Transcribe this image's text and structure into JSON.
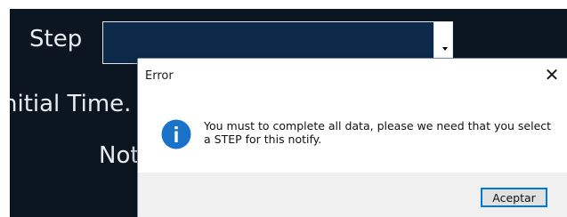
{
  "form": {
    "step_label": "Step",
    "initial_time_label": "nitial Time.",
    "notify_label": "Not",
    "step_select": {
      "selected_value": ""
    }
  },
  "dialog": {
    "title": "Error",
    "close_glyph": "✕",
    "icon": "info-icon",
    "message": "You must to complete all data, please we need that you select a STEP for this notify.",
    "accept_label": "Aceptar"
  },
  "colors": {
    "app_background": "#0b1621",
    "select_background": "#0d2a4a",
    "info_icon": "#1a73c9",
    "button_focus_border": "#0078d7",
    "dialog_footer": "#f0f0f0"
  }
}
